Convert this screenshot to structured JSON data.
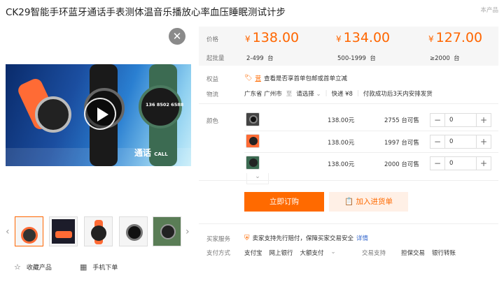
{
  "title": "CK29智能手环蓝牙通话手表测体温音乐播放心率血压睡眠测试计步",
  "corner_text": "本产品",
  "video": {
    "screen_text": "136 8502 6588",
    "overlay_text": "通话",
    "overlay_sub": "CALL"
  },
  "left_actions": {
    "favorite_label": "收藏产品",
    "mobile_label": "手机下单"
  },
  "price": {
    "label": "价格",
    "batch_label": "起批量",
    "currency": "¥",
    "tiers": [
      {
        "price": "138.00",
        "batch": "2-499",
        "unit": "台"
      },
      {
        "price": "134.00",
        "batch": "500-1999",
        "unit": "台"
      },
      {
        "price": "127.00",
        "batch": "≥2000",
        "unit": "台"
      }
    ]
  },
  "rights": {
    "label": "权益",
    "badge": "营",
    "badge_text": "营",
    "text": "查看是否享首单包邮或首单立减"
  },
  "logistics": {
    "label": "物流",
    "from": "广东省 广州市",
    "to_label": "至",
    "select": "请选择",
    "express": "快递 ¥8",
    "ship_note": "付款成功后3天内安排发货"
  },
  "sku": {
    "label": "颜色",
    "rows": [
      {
        "price": "138.00元",
        "stock": "2755 台可售",
        "qty": "0"
      },
      {
        "price": "138.00元",
        "stock": "1997 台可售",
        "qty": "0"
      },
      {
        "price": "138.00元",
        "stock": "2000 台可售",
        "qty": "0"
      }
    ]
  },
  "buttons": {
    "order": "立即订购",
    "cart": "加入进货单"
  },
  "service": {
    "label": "买家服务",
    "text": "卖家支持先行赔付，保障买家交易安全",
    "link": "详情"
  },
  "payment": {
    "label": "支付方式",
    "methods": [
      "支付宝",
      "网上银行",
      "大额支付"
    ],
    "trade_label": "交易支持",
    "trade_methods": [
      "担保交易",
      "银行转账"
    ]
  },
  "colors": {
    "accent": "#ff6a00",
    "link": "#3366cc"
  }
}
